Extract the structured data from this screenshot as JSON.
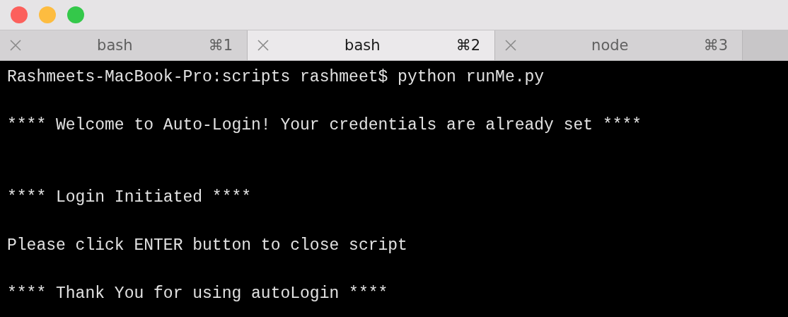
{
  "window": {
    "traffic_lights": [
      {
        "color": "#fc605c"
      },
      {
        "color": "#fdbc40"
      },
      {
        "color": "#34c84a"
      }
    ]
  },
  "tabs": [
    {
      "label": "bash",
      "shortcut": "⌘1",
      "selected": false
    },
    {
      "label": "bash",
      "shortcut": "⌘2",
      "selected": true
    },
    {
      "label": "node",
      "shortcut": "⌘3",
      "selected": false
    }
  ],
  "terminal": {
    "lines": [
      {
        "kind": "text",
        "text": "Rashmeets-MacBook-Pro:scripts rashmeet$ python runMe.py"
      },
      {
        "kind": "blank"
      },
      {
        "kind": "text",
        "text": "**** Welcome to Auto-Login! Your credentials are already set ****"
      },
      {
        "kind": "blank"
      },
      {
        "kind": "blank"
      },
      {
        "kind": "text",
        "text": "**** Login Initiated ****"
      },
      {
        "kind": "blank"
      },
      {
        "kind": "text",
        "text": "Please click ENTER button to close script"
      },
      {
        "kind": "blank"
      },
      {
        "kind": "text",
        "text": "**** Thank You for using autoLogin ****"
      }
    ]
  }
}
